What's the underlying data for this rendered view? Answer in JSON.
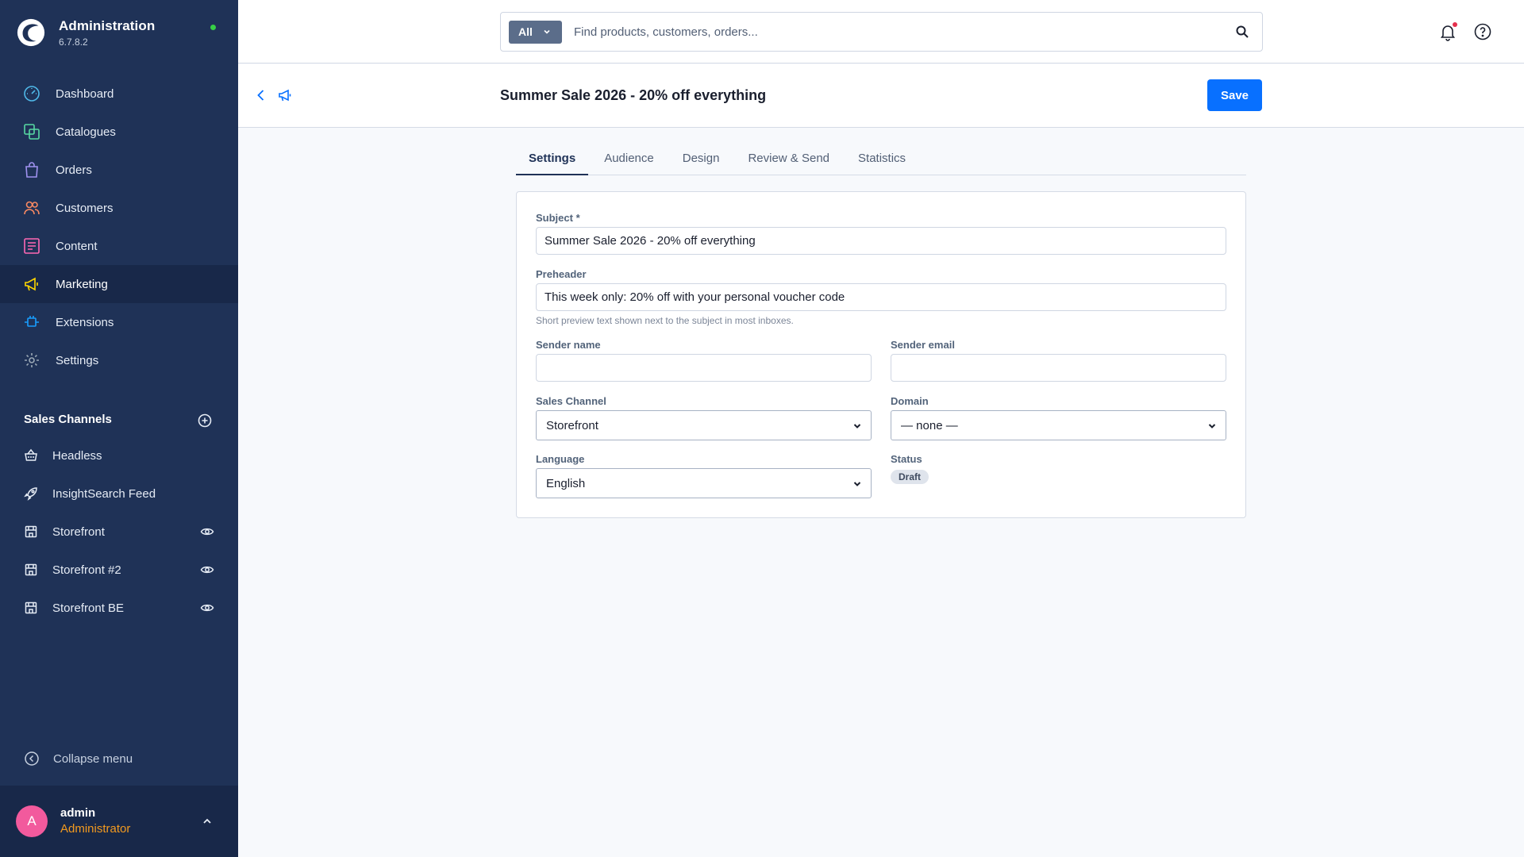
{
  "app": {
    "title": "Administration",
    "version": "6.7.8.2",
    "status_color": "#37d046"
  },
  "sidebar": {
    "items": [
      {
        "label": "Dashboard",
        "icon": "dashboard-icon",
        "color": "#4fb8e8"
      },
      {
        "label": "Catalogues",
        "icon": "catalogue-icon",
        "color": "#57d9a3"
      },
      {
        "label": "Orders",
        "icon": "orders-icon",
        "color": "#a092f0"
      },
      {
        "label": "Customers",
        "icon": "customers-icon",
        "color": "#f88962"
      },
      {
        "label": "Content",
        "icon": "content-icon",
        "color": "#ff68b4"
      },
      {
        "label": "Marketing",
        "icon": "megaphone-icon",
        "color": "#ffd700"
      },
      {
        "label": "Extensions",
        "icon": "plug-icon",
        "color": "#189eff"
      },
      {
        "label": "Settings",
        "icon": "gear-icon",
        "color": "#9aa8b5"
      }
    ],
    "channels_title": "Sales Channels",
    "channels": [
      {
        "label": "Headless",
        "icon": "basket-icon"
      },
      {
        "label": "InsightSearch Feed",
        "icon": "rocket-icon"
      },
      {
        "label": "Storefront",
        "icon": "store-icon",
        "eye": true
      },
      {
        "label": "Storefront #2",
        "icon": "store-icon",
        "eye": true
      },
      {
        "label": "Storefront BE",
        "icon": "store-icon",
        "eye": true
      }
    ],
    "collapse_label": "Collapse menu"
  },
  "user": {
    "initial": "A",
    "name": "admin",
    "role": "Administrator",
    "avatar_color": "#f25a9d",
    "role_color": "#f39a1f"
  },
  "search": {
    "type_label": "All",
    "placeholder": "Find products, customers, orders..."
  },
  "page": {
    "title": "Summer Sale 2026 - 20% off everything",
    "save_label": "Save"
  },
  "tabs": [
    "Settings",
    "Audience",
    "Design",
    "Review & Send",
    "Statistics"
  ],
  "form": {
    "subject_label": "Subject *",
    "subject_value": "Summer Sale 2026 - 20% off everything",
    "preheader_label": "Preheader",
    "preheader_value": "This week only: 20% off with your personal voucher code",
    "preheader_help": "Short preview text shown next to the subject in most inboxes.",
    "sender_name_label": "Sender name",
    "sender_name_value": "",
    "sender_email_label": "Sender email",
    "sender_email_value": "",
    "sales_channel_label": "Sales Channel",
    "sales_channel_value": "Storefront",
    "domain_label": "Domain",
    "domain_value": "— none —",
    "language_label": "Language",
    "language_value": "English",
    "status_label": "Status",
    "status_value": "Draft"
  }
}
